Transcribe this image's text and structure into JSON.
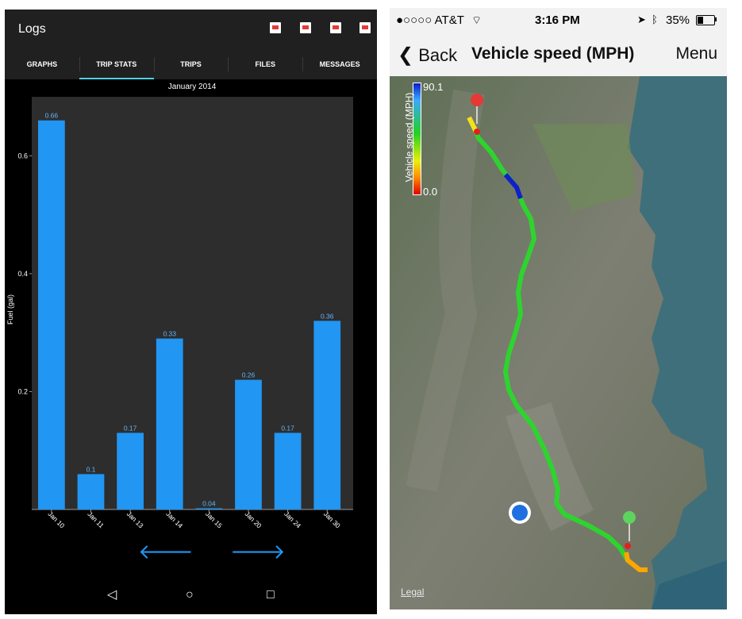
{
  "android": {
    "app_title": "Logs",
    "toolbar_icons": [
      "flag-icon",
      "file-icon",
      "file-icon",
      "mail-icon"
    ],
    "tabs": [
      {
        "label": "GRAPHS",
        "active": false
      },
      {
        "label": "TRIP STATS",
        "active": true
      },
      {
        "label": "TRIPS",
        "active": false
      },
      {
        "label": "FILES",
        "active": false
      },
      {
        "label": "MESSAGES",
        "active": false
      }
    ],
    "accent_color": "#4dd0e1",
    "nav": {
      "prev_icon": "left-arrow-icon",
      "next_icon": "right-arrow-icon"
    },
    "system_nav": {
      "back": "◁",
      "home": "○",
      "recents": "□"
    }
  },
  "chart_data": {
    "type": "bar",
    "title": "January 2014",
    "ylabel": "Fuel (gal)",
    "xlabel": "",
    "categories": [
      "Jan 10",
      "Jan 11",
      "Jan 13",
      "Jan 14",
      "Jan 15",
      "Jan 20",
      "Jan 24",
      "Jan 30"
    ],
    "values": [
      0.66,
      0.1,
      0.17,
      0.33,
      0.04,
      0.26,
      0.17,
      0.36
    ],
    "drawn_values": [
      0.66,
      0.06,
      0.13,
      0.29,
      0.002,
      0.22,
      0.13,
      0.32
    ],
    "data_labels": [
      "0.66",
      "0.1",
      "0.17",
      "0.33",
      "0.04",
      "0.26",
      "0.17",
      "0.36"
    ],
    "yticks": [
      0.2,
      0.4,
      0.6
    ],
    "ytick_labels": [
      "0.2",
      "0.4",
      "0.6"
    ],
    "ylim": [
      0,
      0.7
    ],
    "bar_color": "#2196f3",
    "plot_background": "#2d2d2d",
    "grid": false
  },
  "ios": {
    "status": {
      "carrier": "●○○○○ AT&T",
      "wifi": "wifi-icon",
      "time": "3:16 PM",
      "battery_text": "35%",
      "battery_level": 0.35
    },
    "nav": {
      "back_label": "Back",
      "title": "Vehicle speed (MPH)",
      "menu_label": "Menu"
    },
    "legend": {
      "label": "Vehicle speed (MPH)",
      "max": "90.1",
      "min": "0.0"
    },
    "legal": "Legal",
    "map_icons": [
      "map-pin-red-icon",
      "map-pin-green-icon",
      "current-location-icon",
      "location-arrow-icon",
      "bluetooth-icon"
    ]
  }
}
